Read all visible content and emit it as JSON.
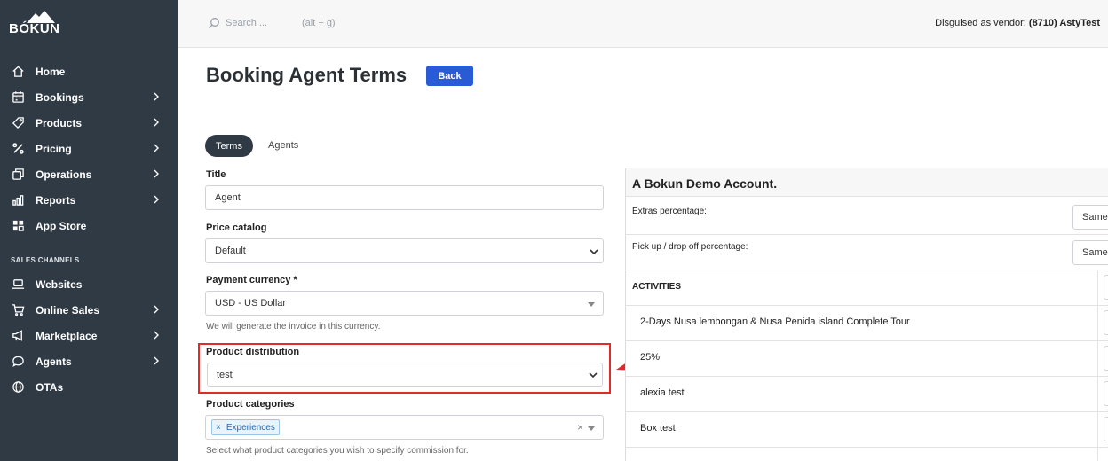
{
  "brand": {
    "name": "BÓKUN"
  },
  "sidebar": {
    "items": [
      {
        "label": "Home",
        "icon": "home-icon",
        "chevron": false
      },
      {
        "label": "Bookings",
        "icon": "calendar-icon",
        "chevron": true
      },
      {
        "label": "Products",
        "icon": "tag-icon",
        "chevron": true
      },
      {
        "label": "Pricing",
        "icon": "percent-icon",
        "chevron": true
      },
      {
        "label": "Operations",
        "icon": "copy-icon",
        "chevron": true
      },
      {
        "label": "Reports",
        "icon": "bar-chart-icon",
        "chevron": true
      },
      {
        "label": "App Store",
        "icon": "grid-icon",
        "chevron": false
      }
    ],
    "section_label": "SALES CHANNELS",
    "channels": [
      {
        "label": "Websites",
        "icon": "laptop-icon",
        "chevron": false
      },
      {
        "label": "Online Sales",
        "icon": "cart-icon",
        "chevron": true
      },
      {
        "label": "Marketplace",
        "icon": "megaphone-icon",
        "chevron": true
      },
      {
        "label": "Agents",
        "icon": "chat-icon",
        "chevron": true
      },
      {
        "label": "OTAs",
        "icon": "globe-icon",
        "chevron": false
      }
    ]
  },
  "topbar": {
    "search_placeholder": "Search ...",
    "search_shortcut": "(alt + g)",
    "disguise_prefix": "Disguised as vendor: ",
    "disguise_vendor": "(8710) AstyTest"
  },
  "page": {
    "title": "Booking Agent Terms",
    "back_label": "Back",
    "tabs": [
      {
        "label": "Terms",
        "active": true
      },
      {
        "label": "Agents",
        "active": false
      }
    ]
  },
  "form": {
    "title_label": "Title",
    "title_value": "Agent",
    "price_catalog_label": "Price catalog",
    "price_catalog_value": "Default",
    "payment_currency_label": "Payment currency *",
    "payment_currency_value": "USD - US Dollar",
    "payment_currency_help": "We will generate the invoice in this currency.",
    "product_distribution_label": "Product distribution",
    "product_distribution_value": "test",
    "product_categories_label": "Product categories",
    "product_categories_tags": [
      "Experiences"
    ],
    "product_categories_clear": "×",
    "product_categories_help": "Select what product categories you wish to specify commission for."
  },
  "panel": {
    "title": "A Bokun Demo Account.",
    "extras_label": "Extras percentage:",
    "extras_value": "Same",
    "pickup_label": "Pick up / drop off percentage:",
    "pickup_value": "Same",
    "activities_label": "ACTIVITIES",
    "activities": [
      "2-Days Nusa lembongan & Nusa Penida island Complete Tour",
      "25%",
      "alexia test",
      "Box test"
    ]
  },
  "colors": {
    "sidebar": "#2f3a45",
    "accent": "#2a5bd7",
    "highlight": "#e02b2b"
  }
}
